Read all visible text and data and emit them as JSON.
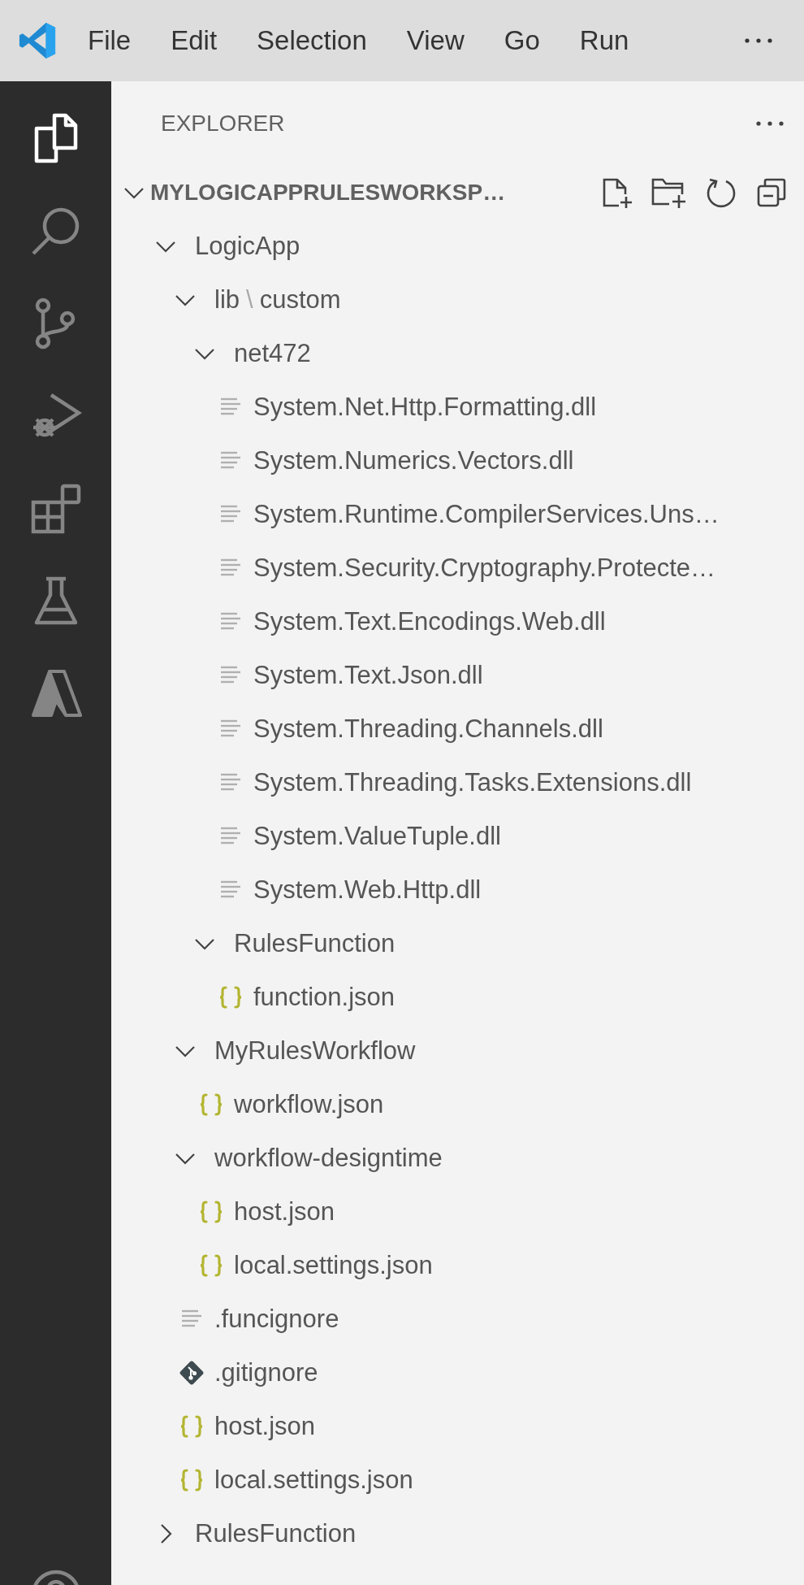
{
  "menu_bar": {
    "items": [
      "File",
      "Edit",
      "Selection",
      "View",
      "Go",
      "Run"
    ]
  },
  "activity_bar": {
    "items": [
      {
        "kind": "files",
        "selected": true
      },
      {
        "kind": "search",
        "selected": false
      },
      {
        "kind": "source-control",
        "selected": false
      },
      {
        "kind": "run-debug",
        "selected": false
      },
      {
        "kind": "extensions",
        "selected": false
      },
      {
        "kind": "testing",
        "selected": false
      },
      {
        "kind": "azure",
        "selected": false
      },
      {
        "kind": "account",
        "selected": false
      }
    ]
  },
  "sidebar": {
    "title": "EXPLORER",
    "root": {
      "label": "MYLOGICAPPRULESWORKSP…",
      "expanded": true
    },
    "tree": [
      {
        "kind": "folder",
        "label": "LogicApp",
        "expanded": true,
        "children": [
          {
            "kind": "folder",
            "label_segments": [
              "lib",
              "custom"
            ],
            "separator": "\\",
            "expanded": true,
            "children": [
              {
                "kind": "folder",
                "label": "net472",
                "expanded": true,
                "children": [
                  {
                    "kind": "text",
                    "label": "System.Net.Http.Formatting.dll"
                  },
                  {
                    "kind": "text",
                    "label": "System.Numerics.Vectors.dll"
                  },
                  {
                    "kind": "text",
                    "label": "System.Runtime.CompilerServices.Uns…"
                  },
                  {
                    "kind": "text",
                    "label": "System.Security.Cryptography.Protecte…"
                  },
                  {
                    "kind": "text",
                    "label": "System.Text.Encodings.Web.dll"
                  },
                  {
                    "kind": "text",
                    "label": "System.Text.Json.dll"
                  },
                  {
                    "kind": "text",
                    "label": "System.Threading.Channels.dll"
                  },
                  {
                    "kind": "text",
                    "label": "System.Threading.Tasks.Extensions.dll"
                  },
                  {
                    "kind": "text",
                    "label": "System.ValueTuple.dll"
                  },
                  {
                    "kind": "text",
                    "label": "System.Web.Http.dll"
                  }
                ]
              },
              {
                "kind": "folder",
                "label": "RulesFunction",
                "expanded": true,
                "children": [
                  {
                    "kind": "json",
                    "label": "function.json"
                  }
                ]
              }
            ]
          },
          {
            "kind": "folder",
            "label": "MyRulesWorkflow",
            "expanded": true,
            "children": [
              {
                "kind": "json",
                "label": "workflow.json"
              }
            ]
          },
          {
            "kind": "folder",
            "label": "workflow-designtime",
            "expanded": true,
            "children": [
              {
                "kind": "json",
                "label": "host.json"
              },
              {
                "kind": "json",
                "label": "local.settings.json"
              }
            ]
          },
          {
            "kind": "text",
            "label": ".funcignore"
          },
          {
            "kind": "git",
            "label": ".gitignore"
          },
          {
            "kind": "json",
            "label": "host.json"
          },
          {
            "kind": "json",
            "label": "local.settings.json"
          }
        ]
      },
      {
        "kind": "folder",
        "label": "RulesFunction",
        "expanded": false
      }
    ]
  }
}
